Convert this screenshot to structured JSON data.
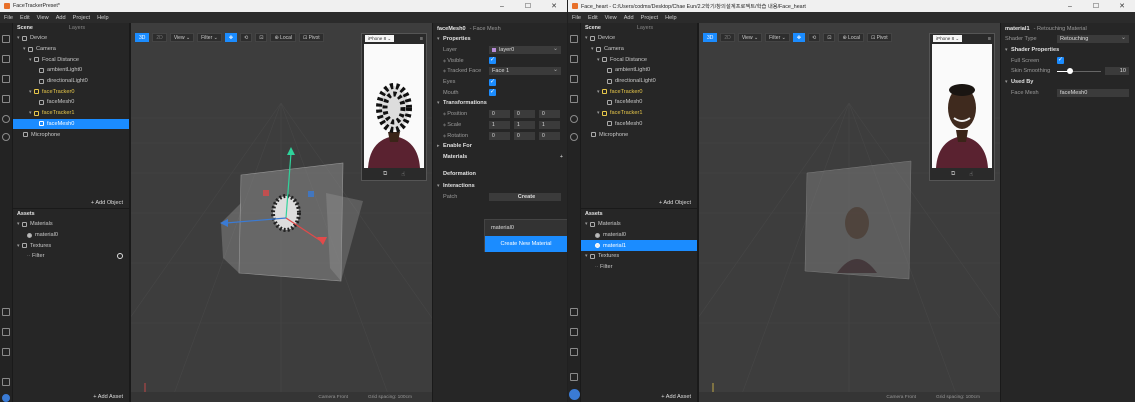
{
  "windows": [
    {
      "title": "FaceTrackerPreset*",
      "controls": {
        "min": "–",
        "max": "☐",
        "close": "✕"
      },
      "menu": [
        "File",
        "Edit",
        "View",
        "Add",
        "Project",
        "Help"
      ],
      "scene": {
        "tabs": [
          "Scene",
          "Layers"
        ],
        "items": [
          {
            "label": "Device",
            "indent": 0,
            "state": "normal"
          },
          {
            "label": "Camera",
            "indent": 1,
            "state": "normal"
          },
          {
            "label": "Focal Distance",
            "indent": 2,
            "state": "normal"
          },
          {
            "label": "ambientLight0",
            "indent": 3,
            "state": "normal"
          },
          {
            "label": "directionalLight0",
            "indent": 3,
            "state": "normal"
          },
          {
            "label": "faceTracker0",
            "indent": 2,
            "state": "yellow"
          },
          {
            "label": "faceMesh0",
            "indent": 3,
            "state": "normal"
          },
          {
            "label": "faceTracker1",
            "indent": 2,
            "state": "yellow"
          },
          {
            "label": "faceMesh0",
            "indent": 3,
            "state": "selected"
          },
          {
            "label": "Microphone",
            "indent": 1,
            "state": "normal"
          }
        ],
        "add_label": "+ Add Object"
      },
      "assets": {
        "title": "Assets",
        "items": [
          {
            "label": "Materials",
            "indent": 0,
            "state": "normal"
          },
          {
            "label": "material0",
            "indent": 1,
            "state": "normal"
          },
          {
            "label": "Textures",
            "indent": 0,
            "state": "normal"
          },
          {
            "label": "Filter",
            "indent": 1,
            "state": "normal"
          }
        ],
        "add_label": "+ Add Asset"
      },
      "viewport": {
        "toolbar": [
          "3D",
          "2D",
          "View ⌄",
          "Filter ⌄",
          "✥",
          "⟲",
          "⊡",
          "⊕ Local",
          "⊡ Pivot"
        ],
        "device": "iPhone 8 ⌄",
        "footer_left": "Camera Front",
        "footer_right": "Grid spacing: 100cm"
      },
      "inspector": {
        "object": "faceMesh0",
        "type": "- Face Mesh",
        "sections": {
          "properties": "Properties",
          "transformations": "Transformations",
          "enable_for": "Enable For",
          "interactions": "Interactions"
        },
        "rows": {
          "layer": {
            "k": "Layer",
            "v": "layer0"
          },
          "visible": {
            "k": "Visible"
          },
          "tracked_face": {
            "k": "Tracked Face",
            "v": "Face 1"
          },
          "eyes": {
            "k": "Eyes"
          },
          "mouth": {
            "k": "Mouth"
          },
          "position": {
            "k": "Position",
            "v": [
              "0",
              "0",
              "0"
            ]
          },
          "scale": {
            "k": "Scale",
            "v": [
              "1",
              "1",
              "1"
            ]
          },
          "rotation": {
            "k": "Rotation",
            "v": [
              "0",
              "0",
              "0"
            ]
          },
          "materials": {
            "k": "Materials",
            "v": "+"
          },
          "deformation": {
            "k": "Deformation"
          },
          "patch": {
            "k": "Patch",
            "v": "Create"
          }
        },
        "popup": {
          "item": "material0",
          "action": "Create New Material"
        }
      }
    },
    {
      "title": "Face_heart - C:/Users/codms/Desktop/Chae Eun/2.2학기/창의설계프로젝트/학습 내용/Face_heart",
      "controls": {
        "min": "–",
        "max": "☐",
        "close": "✕"
      },
      "menu": [
        "File",
        "Edit",
        "View",
        "Add",
        "Project",
        "Help"
      ],
      "scene": {
        "tabs": [
          "Scene",
          "Layers"
        ],
        "items": [
          {
            "label": "Device",
            "indent": 0,
            "state": "normal"
          },
          {
            "label": "Camera",
            "indent": 1,
            "state": "normal"
          },
          {
            "label": "Focal Distance",
            "indent": 2,
            "state": "normal"
          },
          {
            "label": "ambientLight0",
            "indent": 3,
            "state": "normal"
          },
          {
            "label": "directionalLight0",
            "indent": 3,
            "state": "normal"
          },
          {
            "label": "faceTracker0",
            "indent": 2,
            "state": "yellow"
          },
          {
            "label": "faceMesh0",
            "indent": 3,
            "state": "normal"
          },
          {
            "label": "faceTracker1",
            "indent": 2,
            "state": "yellow"
          },
          {
            "label": "faceMesh0",
            "indent": 3,
            "state": "normal"
          },
          {
            "label": "Microphone",
            "indent": 1,
            "state": "normal"
          }
        ],
        "add_label": "+ Add Object"
      },
      "assets": {
        "title": "Assets",
        "items": [
          {
            "label": "Materials",
            "indent": 0,
            "state": "normal"
          },
          {
            "label": "material0",
            "indent": 1,
            "state": "normal"
          },
          {
            "label": "material1",
            "indent": 1,
            "state": "selected"
          },
          {
            "label": "Textures",
            "indent": 0,
            "state": "normal"
          },
          {
            "label": "Filter",
            "indent": 1,
            "state": "normal"
          }
        ],
        "add_label": "+ Add Asset"
      },
      "viewport": {
        "toolbar": [
          "3D",
          "2D",
          "View ⌄",
          "Filter ⌄",
          "✥",
          "⟲",
          "⊡",
          "⊕ Local",
          "⊡ Pivot"
        ],
        "device": "iPhone 8 ⌄",
        "footer_left": "Camera Front",
        "footer_right": "Grid spacing: 100cm"
      },
      "inspector": {
        "object": "material1",
        "type": "- Retouching Material",
        "shader_type": {
          "k": "Shader Type",
          "v": "Retouching"
        },
        "sections": {
          "shader_props": "Shader Properties",
          "used_by": "Used By"
        },
        "rows": {
          "full_screen": {
            "k": "Full Screen"
          },
          "skin_smoothing": {
            "k": "Skin Smoothing",
            "v": "10",
            "level": 0.1
          },
          "face_mesh": {
            "k": "Face Mesh",
            "v": "faceMesh0"
          }
        }
      }
    }
  ],
  "colors": {
    "accent": "#1b8cff",
    "tracker": "#e8c84a",
    "panel": "#262626",
    "viewport": "#3d3d3d"
  }
}
